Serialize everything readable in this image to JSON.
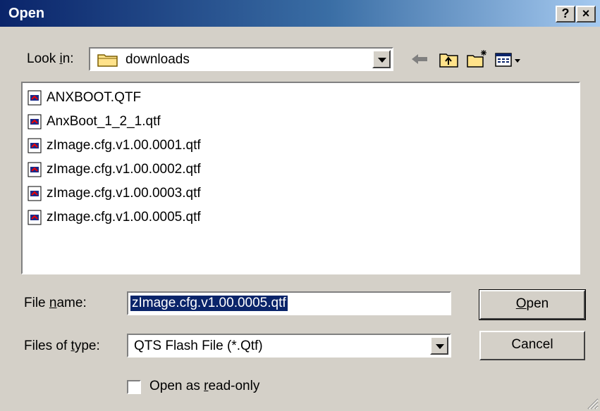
{
  "window": {
    "title": "Open",
    "help_label": "?",
    "close_label": "×"
  },
  "lookin": {
    "label_pre": "Look ",
    "label_u": "i",
    "label_post": "n:",
    "value": "downloads"
  },
  "files": [
    {
      "name": "ANXBOOT.QTF"
    },
    {
      "name": "AnxBoot_1_2_1.qtf"
    },
    {
      "name": "zImage.cfg.v1.00.0001.qtf"
    },
    {
      "name": "zImage.cfg.v1.00.0002.qtf"
    },
    {
      "name": "zImage.cfg.v1.00.0003.qtf"
    },
    {
      "name": "zImage.cfg.v1.00.0005.qtf"
    }
  ],
  "filename": {
    "label_pre": "File ",
    "label_u": "n",
    "label_post": "ame:",
    "value": "zImage.cfg.v1.00.0005.qtf"
  },
  "filetype": {
    "label_pre": "Files of ",
    "label_u": "t",
    "label_post": "ype:",
    "value": "QTS Flash File (*.Qtf)"
  },
  "buttons": {
    "open_u": "O",
    "open_rest": "pen",
    "cancel": "Cancel"
  },
  "readonly": {
    "label_pre": "Open as ",
    "label_u": "r",
    "label_post": "ead-only"
  }
}
